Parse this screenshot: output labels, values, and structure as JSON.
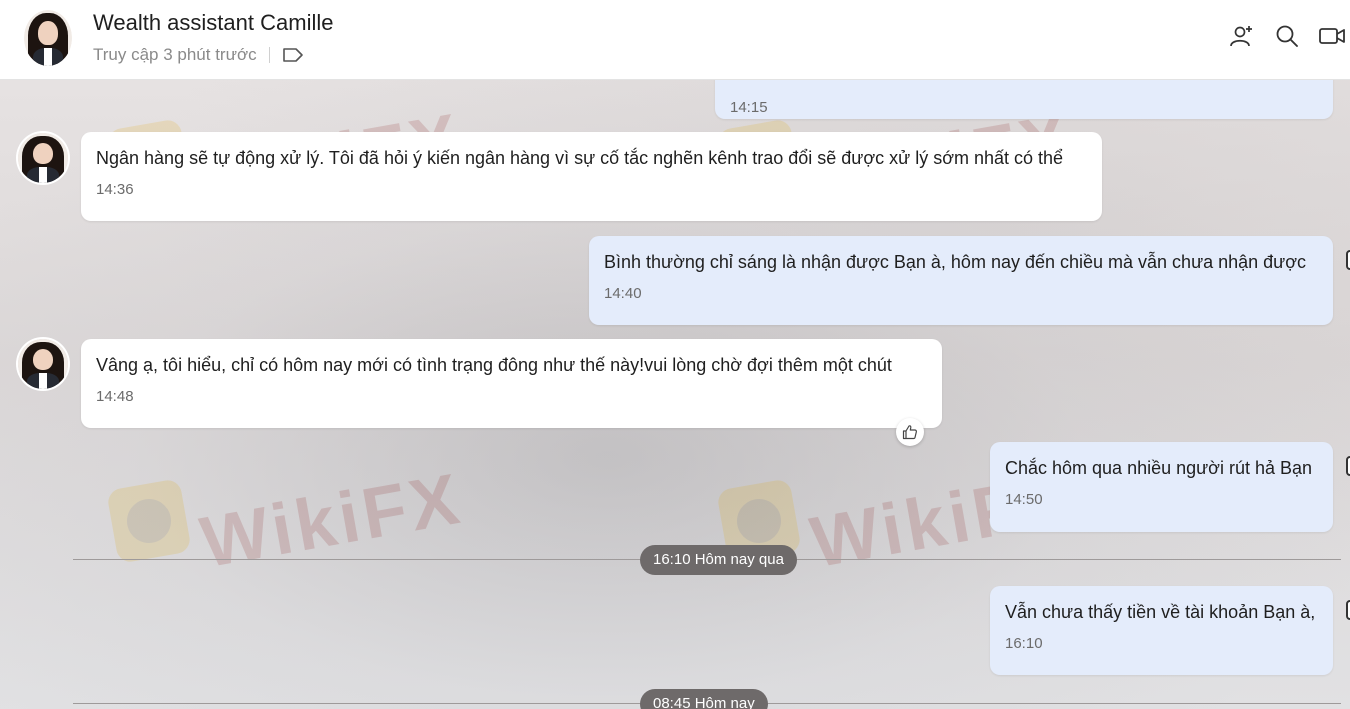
{
  "header": {
    "title": "Wealth assistant Camille",
    "status": "Truy cập 3 phút trước",
    "icons": [
      "add-contact-icon",
      "search-icon",
      "video-call-icon"
    ]
  },
  "watermark": {
    "text": "WikiFX"
  },
  "messages": [
    {
      "direction": "out",
      "text": "",
      "time": "14:15"
    },
    {
      "direction": "in",
      "text": "Ngân hàng sẽ tự động xử lý. Tôi đã hỏi ý kiến ngân hàng vì sự cố tắc nghẽn kênh trao đổi sẽ được xử lý sớm nhất có thể",
      "time": "14:36"
    },
    {
      "direction": "out",
      "text": "Bình thường chỉ sáng là nhận được Bạn à,  hôm nay đến chiều mà vẫn chưa nhận được",
      "time": "14:40"
    },
    {
      "direction": "in",
      "text": "Vâng ạ, tôi hiểu, chỉ có hôm nay mới có tình trạng đông như thế này!vui lòng chờ đợi thêm một chút",
      "time": "14:48"
    },
    {
      "direction": "out",
      "text": "Chắc hôm qua nhiều người rút hả Bạn",
      "time": "14:50"
    },
    {
      "direction": "out",
      "text": "Vẫn chưa thấy tiền về tài khoản Bạn à,",
      "time": "16:10"
    }
  ],
  "dates": {
    "yesterday": "16:10 Hôm nay qua",
    "today": "08:45 Hôm nay"
  }
}
